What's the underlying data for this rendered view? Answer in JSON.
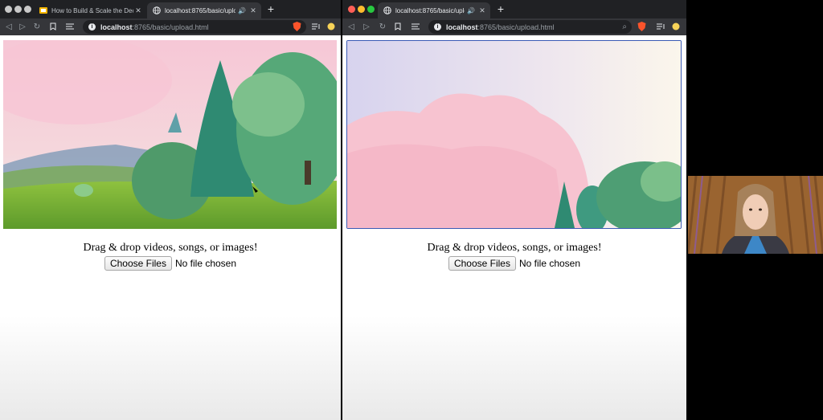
{
  "left_window": {
    "tabs": [
      {
        "title": "How to Build & Scale the Decen",
        "active": false
      },
      {
        "title": "localhost:8765/basic/upload",
        "active": true
      }
    ],
    "url": {
      "host": "localhost",
      "path": ":8765/basic/upload.html"
    },
    "upload": {
      "prompt": "Drag & drop videos, songs, or images!",
      "button_label": "Choose Files",
      "status": "No file chosen"
    }
  },
  "right_window": {
    "tabs": [
      {
        "title": "localhost:8765/basic/upload",
        "active": true
      }
    ],
    "url": {
      "host": "localhost",
      "path": ":8765/basic/upload.html"
    },
    "upload": {
      "prompt": "Drag & drop videos, songs, or images!",
      "button_label": "Choose Files",
      "status": "No file chosen"
    }
  },
  "colors": {
    "tab_bar": "#202124",
    "toolbar": "#35363a",
    "close_dot": "#ff5f57",
    "minimize_dot": "#febc2e",
    "zoom_dot": "#28c840",
    "focus_ring": "#3b5bb5",
    "brave_shield": "#fb542b"
  }
}
